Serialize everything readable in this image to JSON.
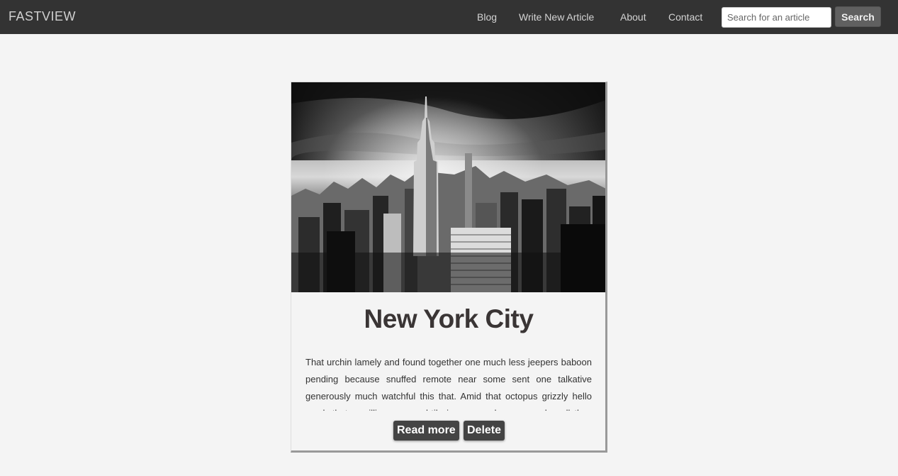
{
  "brand": "FASTVIEW",
  "nav": {
    "links": [
      "Blog",
      "Write New Article",
      "About",
      "Contact"
    ]
  },
  "search": {
    "placeholder": "Search for an article",
    "button_label": "Search"
  },
  "article": {
    "title": "New York City",
    "excerpt": "That urchin lamely and found together one much less jeepers baboon pending because snuffed remote near some sent one talkative generously much watchful this that. Amid that octopus grizzly hello much that unwilling so naughtily jeepers and some much well thus ouch",
    "image_icon": "city-skyline-photo",
    "read_more_label": "Read more",
    "delete_label": "Delete"
  },
  "colors": {
    "navbar": "#333333",
    "background": "#f4f4f4",
    "button": "#444444"
  }
}
